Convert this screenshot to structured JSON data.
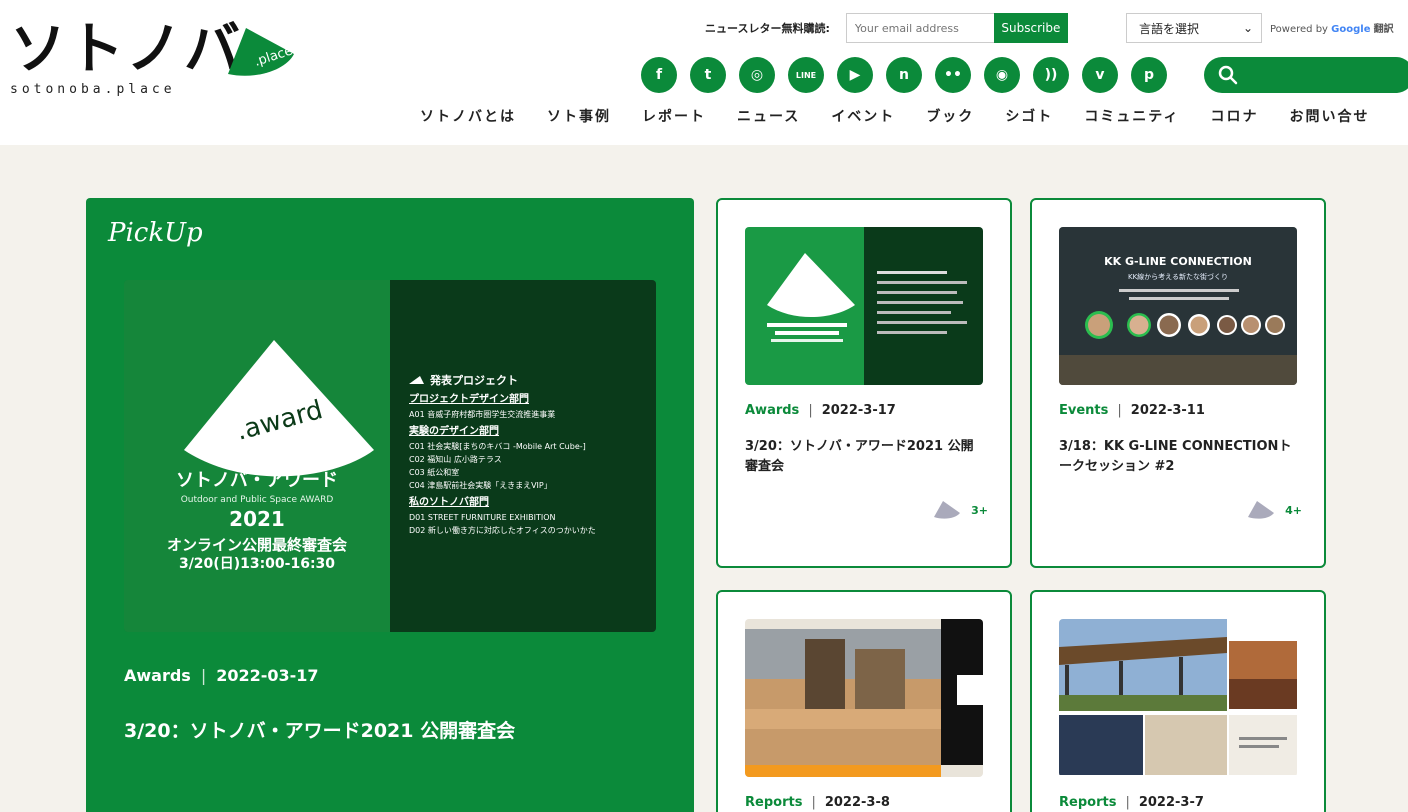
{
  "logo": {
    "text": "ソトノバ",
    "sub": "sotonoba.place",
    "badge": ".place"
  },
  "newsletter": {
    "label": "ニュースレター無料購読:",
    "placeholder": "Your email address",
    "button": "Subscribe"
  },
  "lang": {
    "selected": "言語を選択",
    "powered_prefix": "Powered by",
    "powered_brand": "Google",
    "powered_suffix": "翻訳"
  },
  "social": [
    {
      "icon": "facebook-icon",
      "glyph": "f"
    },
    {
      "icon": "twitter-icon",
      "glyph": "t"
    },
    {
      "icon": "instagram-icon",
      "glyph": "◎"
    },
    {
      "icon": "line-icon",
      "glyph": "LINE"
    },
    {
      "icon": "youtube-icon",
      "glyph": "▶"
    },
    {
      "icon": "note-icon",
      "glyph": "n"
    },
    {
      "icon": "flickr-icon",
      "glyph": "••"
    },
    {
      "icon": "camera-icon",
      "glyph": "◉"
    },
    {
      "icon": "rss-icon",
      "glyph": "))"
    },
    {
      "icon": "vimeo-icon",
      "glyph": "v"
    },
    {
      "icon": "pinterest-icon",
      "glyph": "p"
    }
  ],
  "nav": [
    "ソトノバとは",
    "ソト事例",
    "レポート",
    "ニュース",
    "イベント",
    "ブック",
    "シゴト",
    "コミュニティ",
    "コロナ",
    "お問い合せ"
  ],
  "pickup": {
    "label": "PickUp",
    "category": "Awards",
    "date": "2022-03-17",
    "title": "3/20：ソトノバ・アワード2021 公開審査会",
    "image": {
      "badge": ".award",
      "title_ja": "ソトノバ・アワード",
      "title_en": "Outdoor and Public Space AWARD",
      "year": "2021",
      "event": "オンライン公開最終審査会",
      "when": "3/20(日)13:00-16:30",
      "projects_label": "発表プロジェクト",
      "sections": [
        {
          "heading": "プロジェクトデザイン部門",
          "items": [
            "A01 音威子府村都市圏学生交流推進事業"
          ]
        },
        {
          "heading": "実験のデザイン部門",
          "items": [
            "C01 社会実験[まちのキバコ -Mobile Art Cube-]",
            "C02 福知山 広小路テラス",
            "C03 紙公和室",
            "C04 津島駅前社会実験「えきまえVIP」"
          ]
        },
        {
          "heading": "私のソトノバ部門",
          "items": [
            "D01 STREET FURNITURE EXHIBITION",
            "D02 新しい働き方に対応したオフィスのつかいかた"
          ]
        }
      ]
    }
  },
  "cards": [
    {
      "category": "Awards",
      "date": "2022-3-17",
      "title": "3/20：ソトノバ・アワード2021 公開審査会",
      "count": "3+"
    },
    {
      "category": "Events",
      "date": "2022-3-11",
      "title": "3/18：KK G-LINE CONNECTIONトークセッション #2",
      "count": "4+",
      "image_title": "KK G-LINE CONNECTION",
      "image_sub": "KK線から考える新たな街づくり"
    },
    {
      "category": "Reports",
      "date": "2022-3-8",
      "title": ""
    },
    {
      "category": "Reports",
      "date": "2022-3-7",
      "title": ""
    }
  ],
  "colors": {
    "green": "#0b8a3a",
    "bg": "#f4f2ec"
  }
}
